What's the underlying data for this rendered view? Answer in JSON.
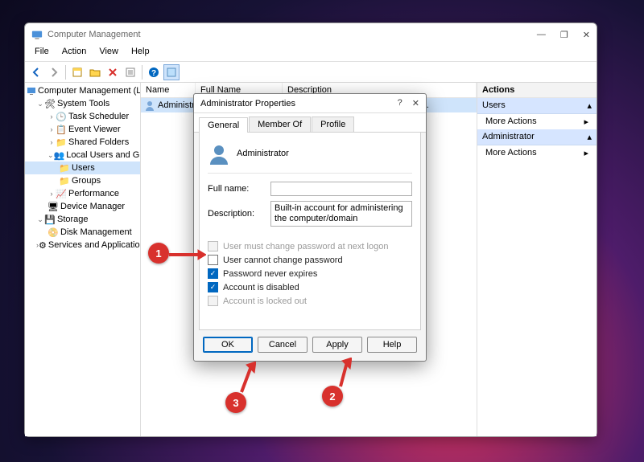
{
  "window": {
    "title": "Computer Management",
    "menus": [
      "File",
      "Action",
      "View",
      "Help"
    ]
  },
  "tree": {
    "root": "Computer Management (Local",
    "system_tools": "System Tools",
    "task_scheduler": "Task Scheduler",
    "event_viewer": "Event Viewer",
    "shared_folders": "Shared Folders",
    "local_users": "Local Users and Groups",
    "users": "Users",
    "groups": "Groups",
    "performance": "Performance",
    "device_manager": "Device Manager",
    "storage": "Storage",
    "disk_mgmt": "Disk Management",
    "services": "Services and Applications"
  },
  "list": {
    "headers": {
      "name": "Name",
      "fullname": "Full Name",
      "description": "Description"
    },
    "rows": {
      "0": {
        "name": "Administrator",
        "fullname": "",
        "description": "Built-in account for administering..."
      }
    }
  },
  "actions": {
    "title": "Actions",
    "s1": "Users",
    "more1": "More Actions",
    "s2": "Administrator",
    "more2": "More Actions",
    "caret": "▸",
    "collapse": "▴"
  },
  "dialog": {
    "title": "Administrator Properties",
    "help": "?",
    "close": "✕",
    "tabs": {
      "general": "General",
      "memberof": "Member Of",
      "profile": "Profile"
    },
    "username": "Administrator",
    "fullname_label": "Full name:",
    "fullname_value": "",
    "description_label": "Description:",
    "description_value": "Built-in account for administering the computer/domain",
    "c1": "User must change password at next logon",
    "c2": "User cannot change password",
    "c3": "Password never expires",
    "c4": "Account is disabled",
    "c5": "Account is locked out",
    "buttons": {
      "ok": "OK",
      "cancel": "Cancel",
      "apply": "Apply",
      "help": "Help"
    }
  },
  "annotations": {
    "b1": "1",
    "b2": "2",
    "b3": "3"
  }
}
